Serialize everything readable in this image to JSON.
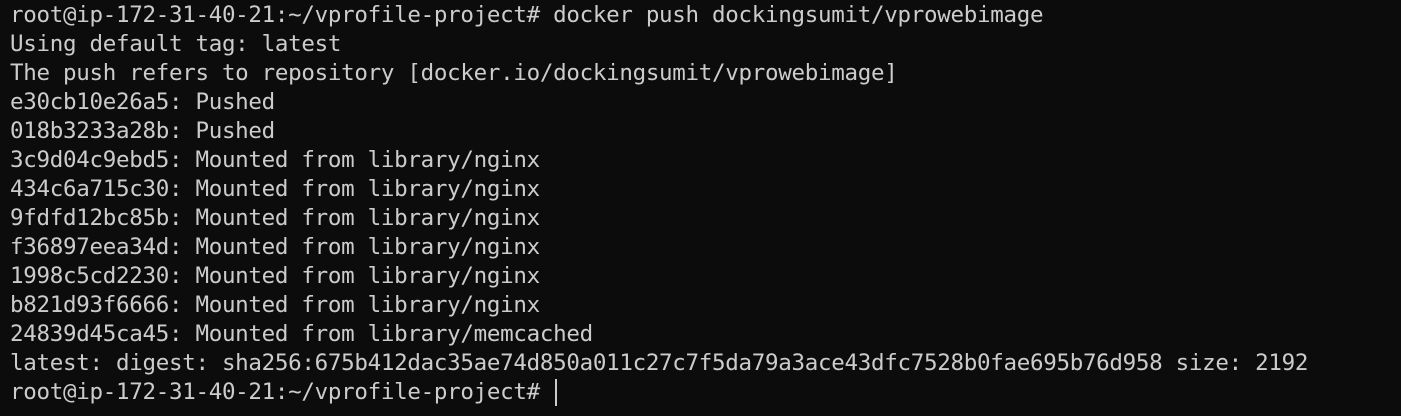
{
  "terminal": {
    "colors": {
      "background": "#0c0c0c",
      "foreground": "#cccccc"
    },
    "lines": [
      "root@ip-172-31-40-21:~/vprofile-project# docker push dockingsumit/vprowebimage",
      "Using default tag: latest",
      "The push refers to repository [docker.io/dockingsumit/vprowebimage]",
      "e30cb10e26a5: Pushed",
      "018b3233a28b: Pushed",
      "3c9d04c9ebd5: Mounted from library/nginx",
      "434c6a715c30: Mounted from library/nginx",
      "9fdfd12bc85b: Mounted from library/nginx",
      "f36897eea34d: Mounted from library/nginx",
      "1998c5cd2230: Mounted from library/nginx",
      "b821d93f6666: Mounted from library/nginx",
      "24839d45ca45: Mounted from library/memcached",
      "latest: digest: sha256:675b412dac35ae74d850a011c27c7f5da79a3ace43dfc7528b0fae695b76d958 size: 2192"
    ],
    "prompt": "root@ip-172-31-40-21:~/vprofile-project# "
  }
}
